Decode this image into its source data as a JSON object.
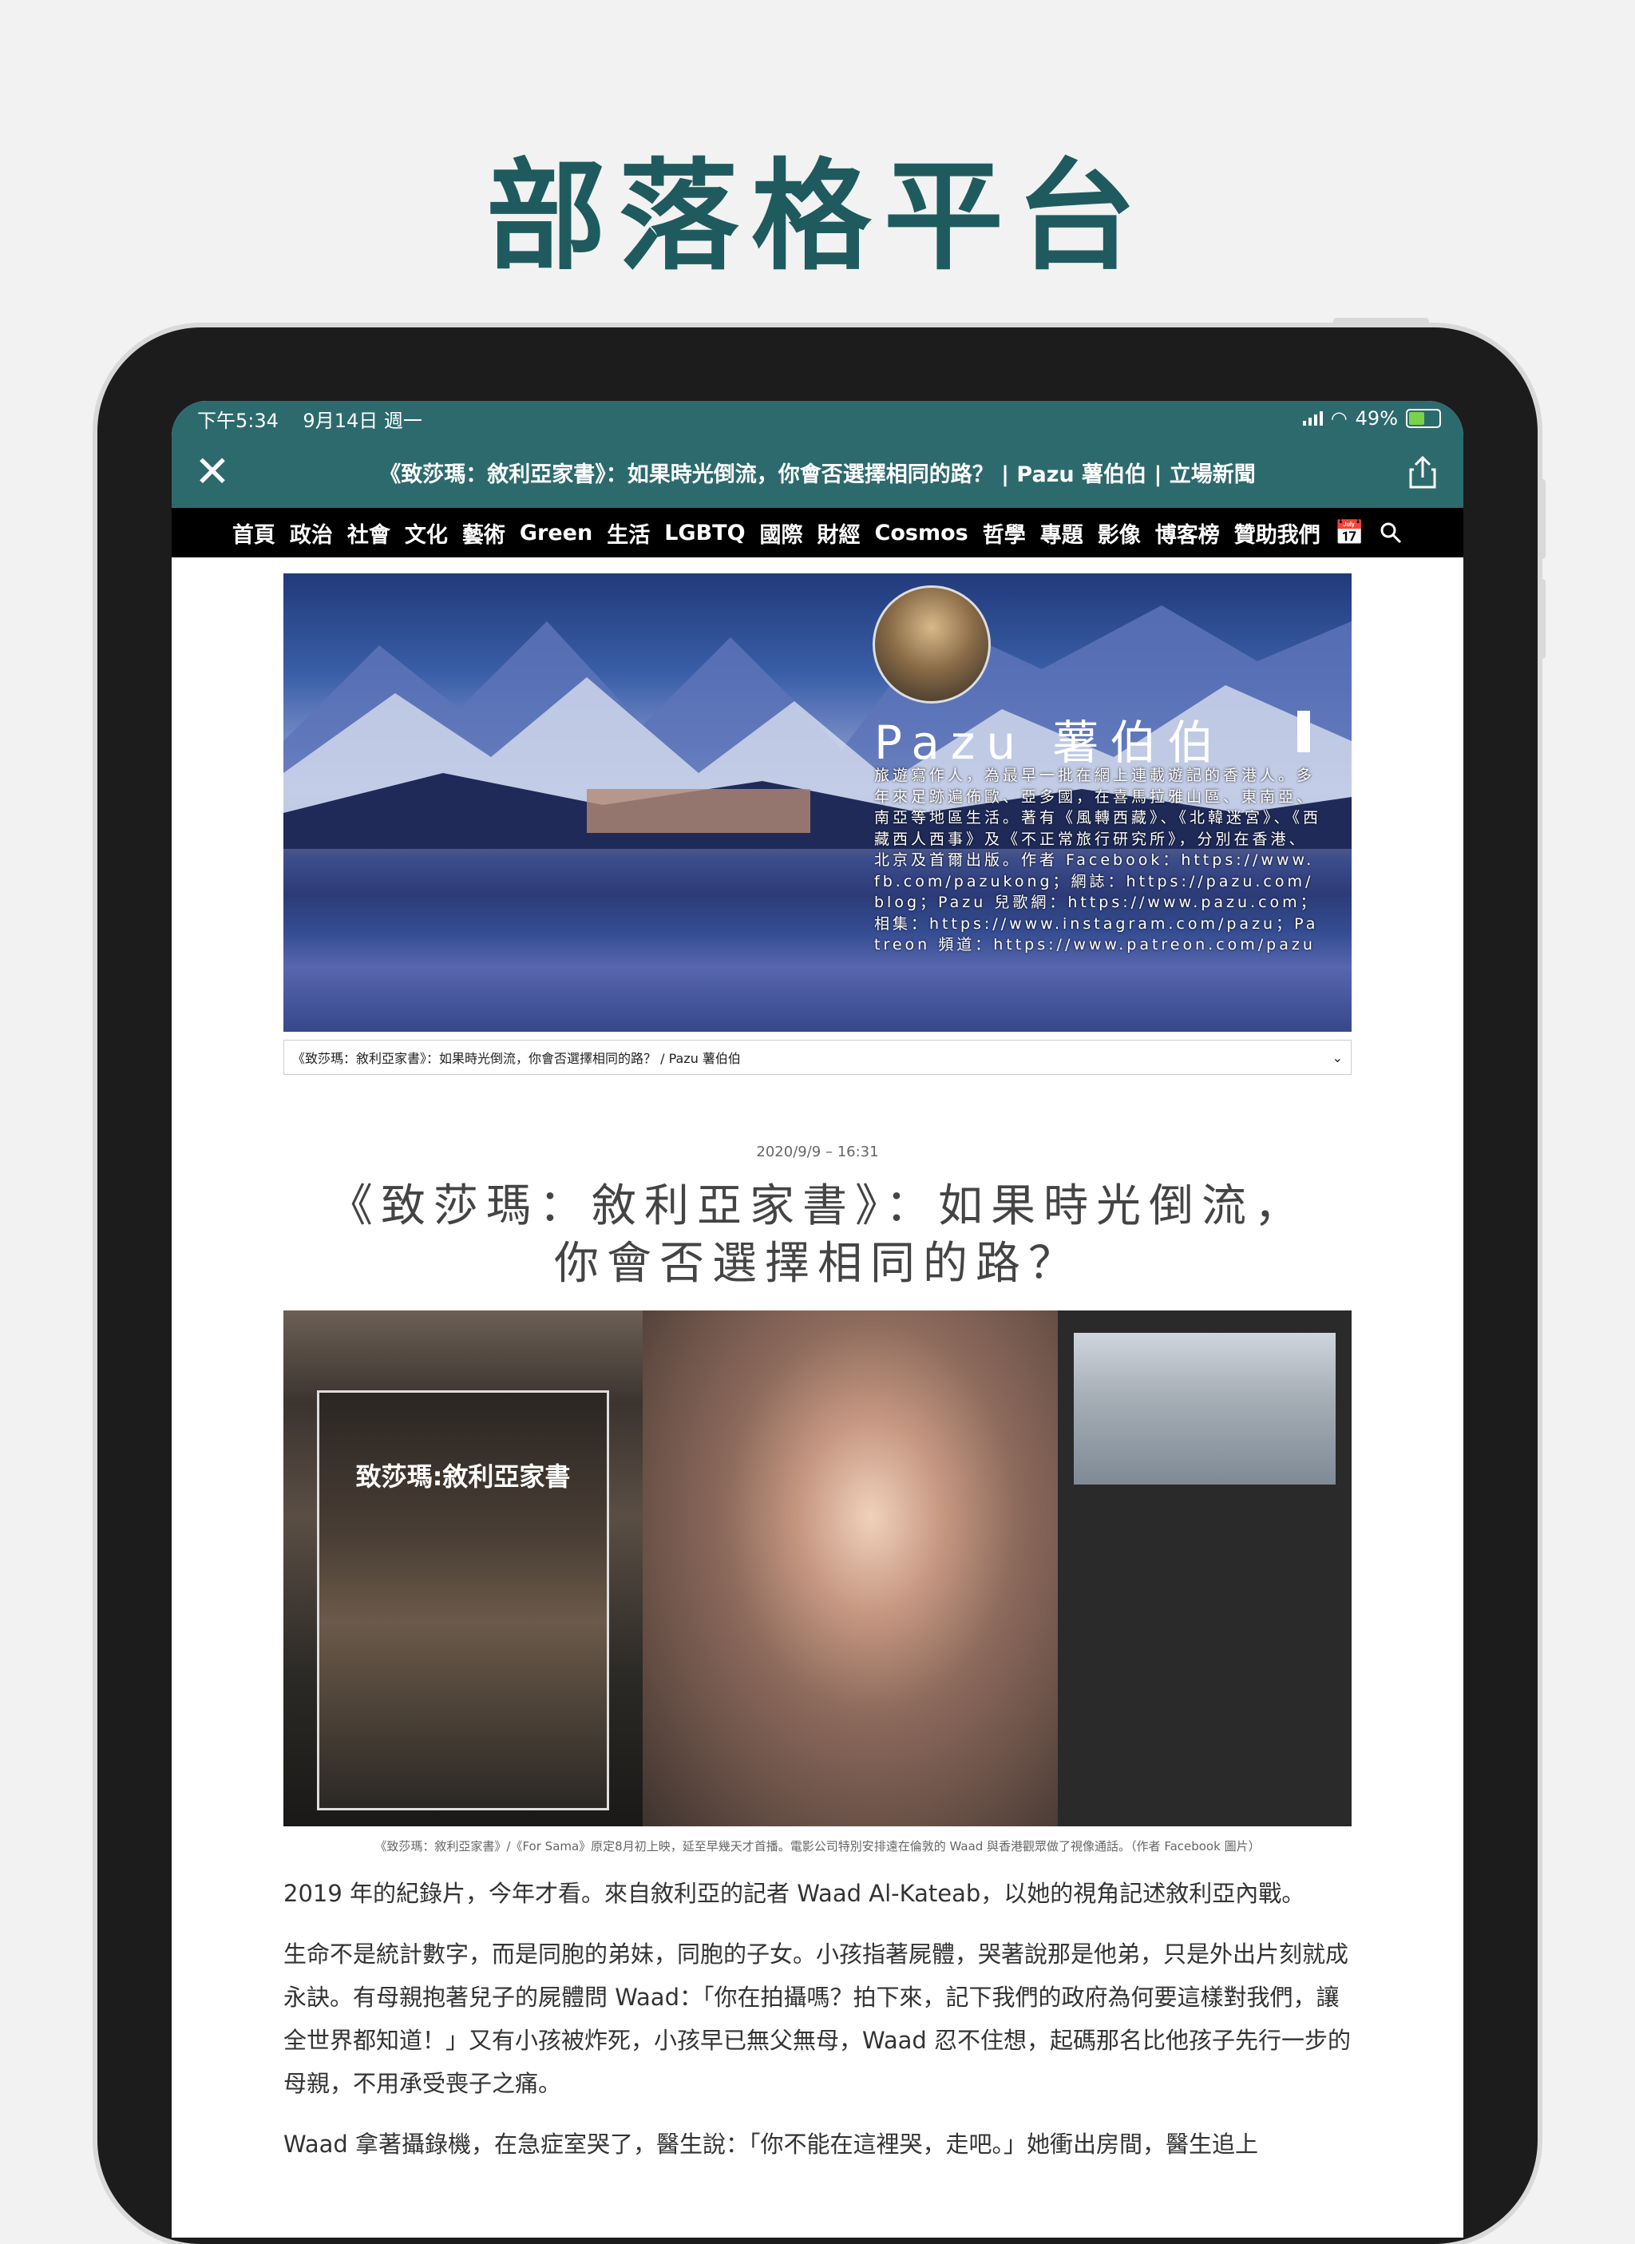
{
  "promo": {
    "title": "部落格平台"
  },
  "status": {
    "time": "下午5:34",
    "date": "9月14日 週一",
    "battery": "49%"
  },
  "nav": {
    "title": "《致莎瑪：敘利亞家書》：如果時光倒流，你會否選擇相同的路？ | Pazu 薯伯伯 | 立場新聞"
  },
  "menu": {
    "items": [
      "首頁",
      "政治",
      "社會",
      "文化",
      "藝術",
      "Green",
      "生活",
      "LGBTQ",
      "國際",
      "財經",
      "Cosmos",
      "哲學",
      "專題",
      "影像",
      "博客榜",
      "贊助我們"
    ]
  },
  "banner": {
    "name": "Pazu 薯伯伯",
    "bio": "旅遊寫作人，為最早一批在網上連載遊記的香港人。多年來足跡遍佈歐、亞多國，在喜馬拉雅山區、東南亞、南亞等地區生活。著有《風轉西藏》、《北韓迷宮》、《西藏西人西事》及《不正常旅行研究所》，分別在香港、北京及首爾出版。作者 Facebook：https://www.fb.com/pazukong；網誌：https://pazu.com/blog；Pazu 兒歌網：https://www.pazu.com；相集：https://www.instagram.com/pazu；Patreon 頻道：https://www.patreon.com/pazu"
  },
  "select": {
    "value": "《致莎瑪：敘利亞家書》：如果時光倒流，你會否選擇相同的路？ / Pazu 薯伯伯"
  },
  "post": {
    "date": "2020/9/9 – 16:31",
    "title_line1": "《致莎瑪：敘利亞家書》：如果時光倒流，",
    "title_line2": "你會否選擇相同的路？",
    "poster_title": "致莎瑪:敘利亞家書",
    "caption": "《致莎瑪：敘利亞家書》/《For Sama》原定8月初上映，延至早幾天才首播。電影公司特別安排遠在倫敦的 Waad 與香港觀眾做了視像通話。（作者 Facebook 圖片）",
    "paragraphs": [
      "2019 年的紀錄片，今年才看。來自敘利亞的記者 Waad Al-Kateab，以她的視角記述敘利亞內戰。",
      "生命不是統計數字，而是同胞的弟妹，同胞的子女。小孩指著屍體，哭著說那是他弟，只是外出片刻就成永訣。有母親抱著兒子的屍體問 Waad：「你在拍攝嗎？拍下來，記下我們的政府為何要這樣對我們，讓全世界都知道！」又有小孩被炸死，小孩早已無父無母，Waad 忍不住想，起碼那名比他孩子先行一步的母親，不用承受喪子之痛。",
      "Waad 拿著攝錄機，在急症室哭了，醫生說：「你不能在這裡哭，走吧。」她衝出房間，醫生追上"
    ]
  },
  "colors": {
    "teal": "#2d6a6d",
    "title_teal": "#1f5b5e"
  }
}
